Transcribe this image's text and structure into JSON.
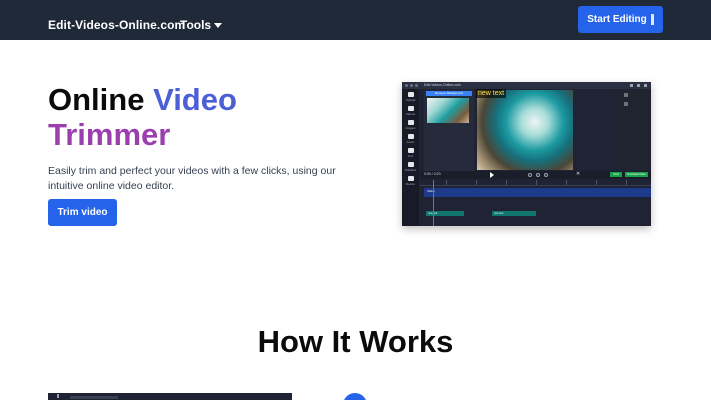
{
  "nav": {
    "brand": "Edit-Videos-Online.com",
    "tools_label": "Tools",
    "start_button": "Start Editing",
    "background": "#1f2937"
  },
  "hero": {
    "title_word1": "Online",
    "title_word2": "Video",
    "title_word3": "Trimmer",
    "description": "Easily trim and perfect your videos with a few clicks, using our intuitive online video editor.",
    "cta_button": "Trim video",
    "accent": "#2563eb",
    "gradient_colors": [
      "#4c5fd6",
      "#9b3fae"
    ]
  },
  "editor_preview": {
    "window_title": "Edit-Videos-Online.com",
    "sidebar_items": [
      "Upload",
      "Videos",
      "Images",
      "Audio",
      "Text",
      "Subtitles",
      "Resize"
    ],
    "media_tag": "Remove Background",
    "overlay_text": "new text",
    "time": "0:00 / 0:20",
    "undo_label": "Undo",
    "download_label": "Download Video",
    "video_track_label": "Video",
    "clip1_label": "new text",
    "clip2_label": "new text"
  },
  "how": {
    "title": "How It Works"
  }
}
